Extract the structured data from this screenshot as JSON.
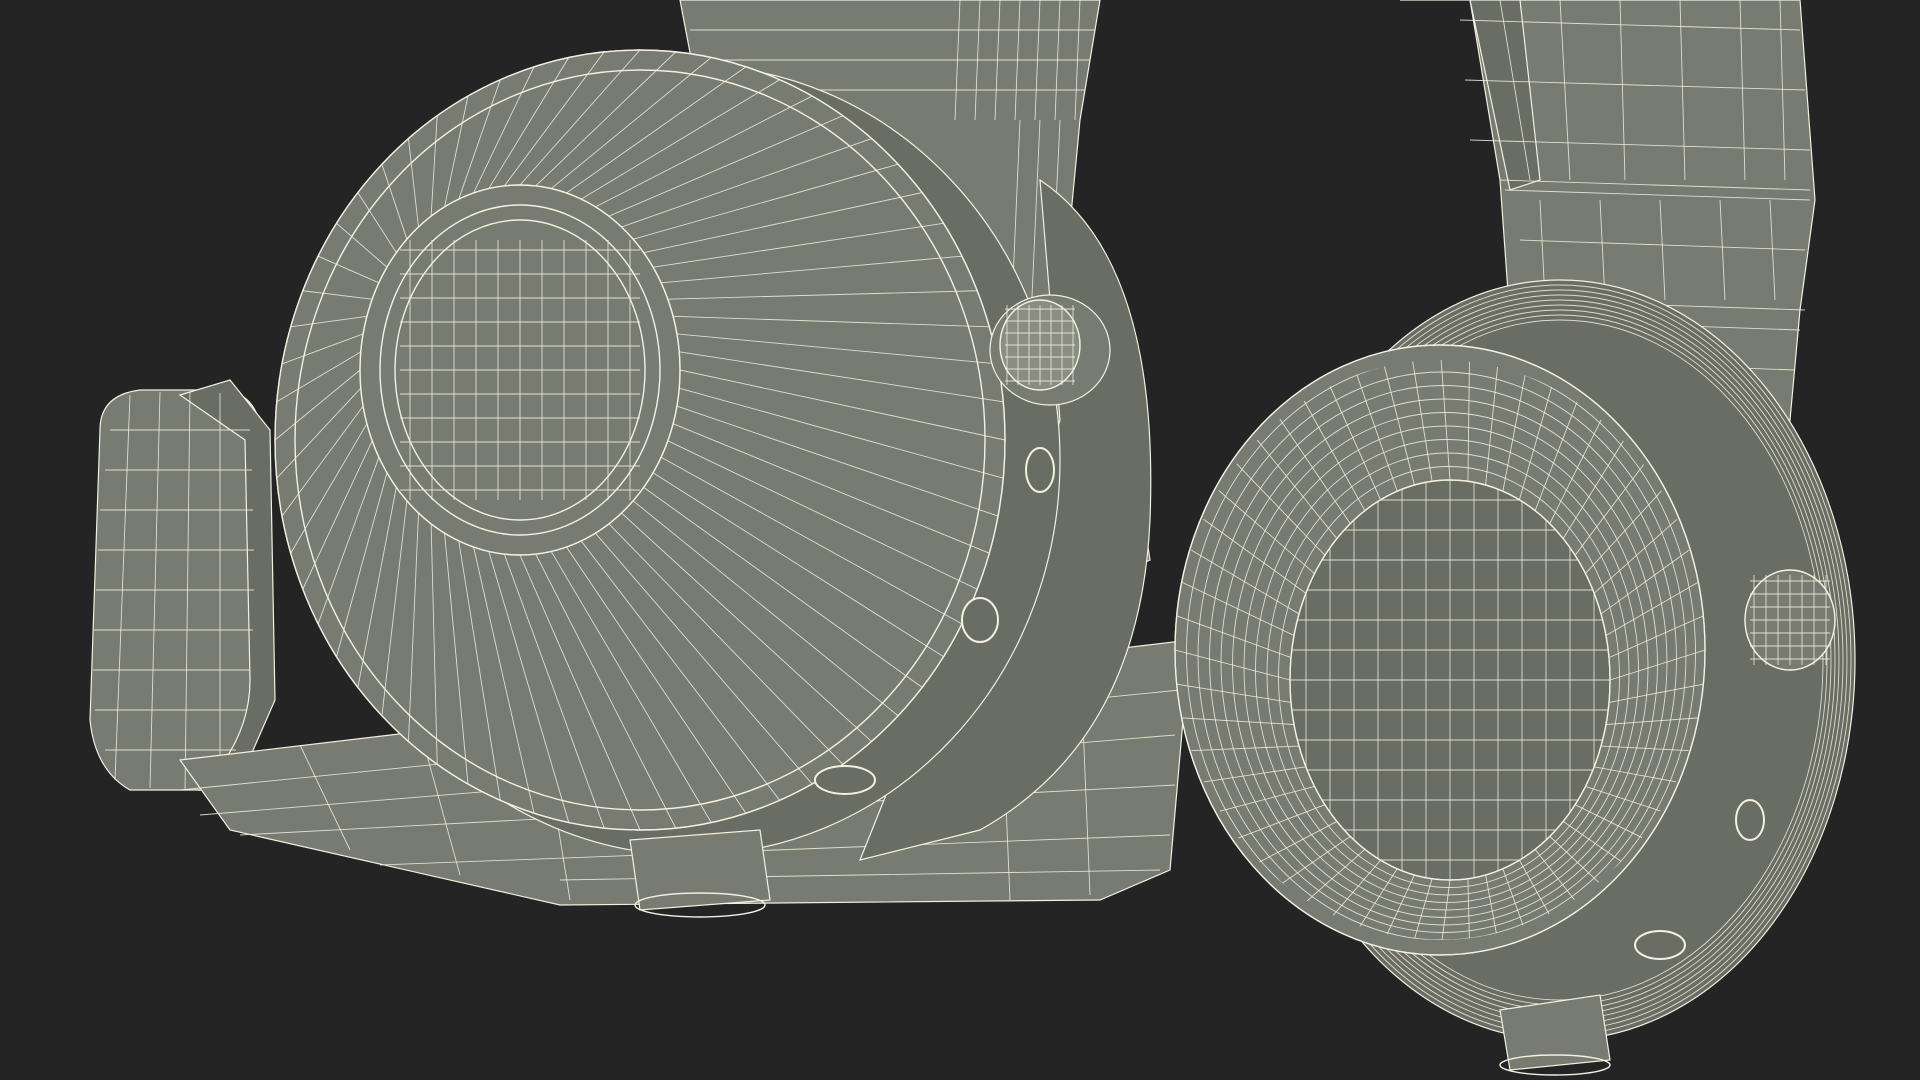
{
  "scene": {
    "subject": "headphones-wireframe",
    "background_color": "#242424",
    "surface_color": "#787b71",
    "surface_dark_color": "#6a6d63",
    "surface_light_color": "#8a8d83",
    "wire_color": "#f2f0e0"
  }
}
